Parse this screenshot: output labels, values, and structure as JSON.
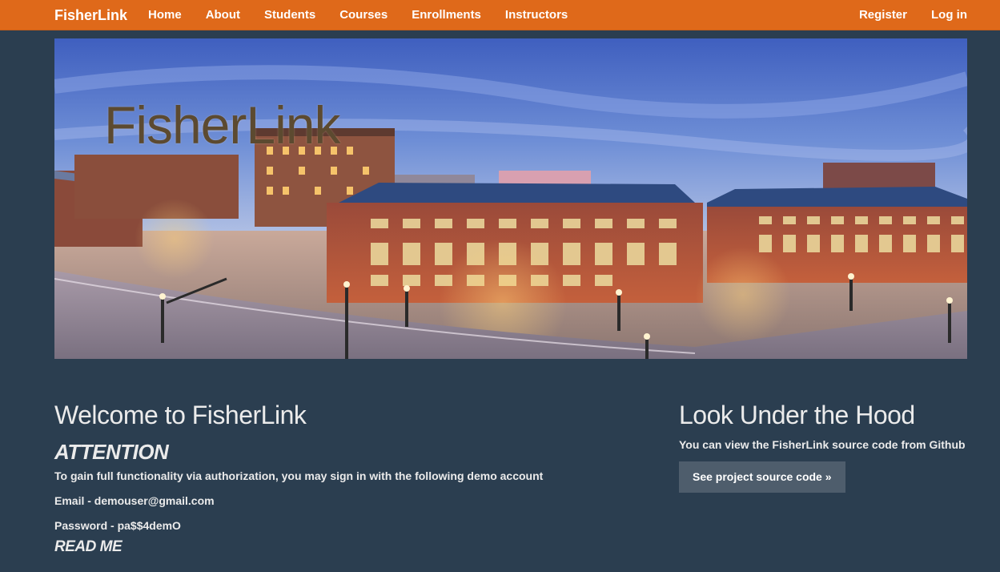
{
  "navbar": {
    "brand": "FisherLink",
    "left_links": [
      "Home",
      "About",
      "Students",
      "Courses",
      "Enrollments",
      "Instructors"
    ],
    "right_links": [
      "Register",
      "Log in"
    ],
    "color": "#df691a"
  },
  "hero": {
    "title": "FisherLink"
  },
  "welcome": {
    "title": "Welcome to FisherLink",
    "attention_heading": "ATTENTION",
    "attention_text": "To gain full functionality via authorization, you may sign in with the following demo account",
    "email_line": "Email - demouser@gmail.com",
    "password_line": "Password - pa$$4demO",
    "readme_heading": "READ ME"
  },
  "hood": {
    "title": "Look Under the Hood",
    "text": "You can view the FisherLink source code from Github",
    "button_label": "See project source code »"
  },
  "colors": {
    "background": "#2b3e50",
    "accent": "#df691a",
    "button": "#4e5d6c",
    "text": "#ebebeb"
  }
}
